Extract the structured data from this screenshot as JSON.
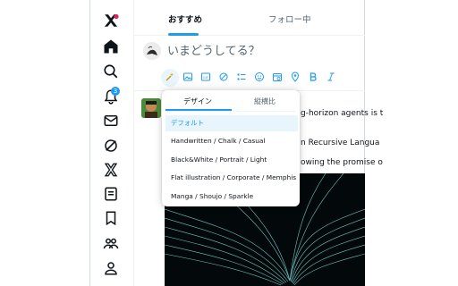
{
  "tabs": {
    "recommended": "おすすめ",
    "following": "フォロー中"
  },
  "compose": {
    "placeholder": "いまどうしてる？"
  },
  "sidebar": {
    "notification_count": "3"
  },
  "dropdown": {
    "tabs": [
      "デザイン",
      "縦横比"
    ],
    "items": [
      "デフォルト",
      "Handwritten / Chalk / Casual",
      "Black&White / Portrait / Light",
      "Flat illustration / Corporate / Memphis",
      "Manga / Shoujo / Sparkle"
    ],
    "selected_index": 0
  },
  "post": {
    "line1": "g-horizon agents is t",
    "line2": "n Recursive Langua",
    "line3": "owing the promise o"
  },
  "colors": {
    "accent": "#1d9bf0",
    "text": "#0f1419",
    "muted": "#536471",
    "selected_bg": "#e8f5fd"
  }
}
